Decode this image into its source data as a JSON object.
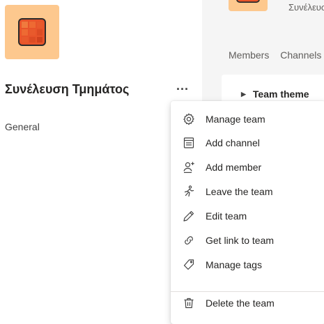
{
  "team": {
    "name": "Συνέλευση Τμημάτος",
    "more_label": "...",
    "channels": [
      "General"
    ]
  },
  "header": {
    "subtitle": "Συνέλευση Τμημάτος"
  },
  "tabs": [
    {
      "label": "Members"
    },
    {
      "label": "Channels"
    }
  ],
  "settings": {
    "team_theme_label": "Team theme"
  },
  "menu": {
    "items": [
      {
        "label": "Manage team",
        "icon": "gear-icon"
      },
      {
        "label": "Add channel",
        "icon": "channel-list-icon"
      },
      {
        "label": "Add member",
        "icon": "add-person-icon"
      },
      {
        "label": "Leave the team",
        "icon": "leave-icon"
      },
      {
        "label": "Edit team",
        "icon": "pencil-icon"
      },
      {
        "label": "Get link to team",
        "icon": "link-icon"
      },
      {
        "label": "Manage tags",
        "icon": "tag-icon"
      },
      {
        "label": "Delete the team",
        "icon": "trash-icon"
      }
    ]
  },
  "colors": {
    "avatar_bg": "#fdc88e",
    "avatar_tile": "#e8542a",
    "right_pane_bg": "#f5f5f5"
  }
}
